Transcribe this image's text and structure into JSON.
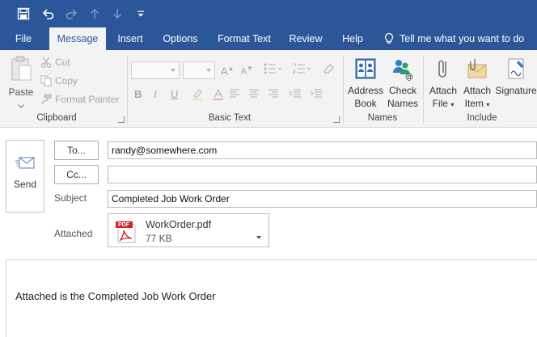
{
  "qat": {
    "icons": [
      "save-icon",
      "undo-icon",
      "redo-icon",
      "up-arrow-icon",
      "down-arrow-icon",
      "customize-icon"
    ]
  },
  "tabs": [
    {
      "label": "File",
      "active": false
    },
    {
      "label": "Message",
      "active": true
    },
    {
      "label": "Insert",
      "active": false
    },
    {
      "label": "Options",
      "active": false
    },
    {
      "label": "Format Text",
      "active": false
    },
    {
      "label": "Review",
      "active": false
    },
    {
      "label": "Help",
      "active": false
    }
  ],
  "tellme": {
    "label": "Tell me what you want to do",
    "icon": "lightbulb-icon"
  },
  "ribbon": {
    "clipboard": {
      "paste": "Paste",
      "cut": "Cut",
      "copy": "Copy",
      "format_painter": "Format Painter",
      "group": "Clipboard"
    },
    "basic_text": {
      "bold": "B",
      "italic": "I",
      "underline": "U",
      "group": "Basic Text"
    },
    "names": {
      "address_book_1": "Address",
      "address_book_2": "Book",
      "check_names_1": "Check",
      "check_names_2": "Names",
      "group": "Names"
    },
    "include": {
      "attach_file_1": "Attach",
      "attach_file_2": "File",
      "attach_item_1": "Attach",
      "attach_item_2": "Item",
      "signature": "Signature",
      "group": "Include"
    }
  },
  "compose": {
    "send": "Send",
    "to_button": "To...",
    "cc_button": "Cc...",
    "to_value": "randy@somewhere.com",
    "cc_value": "",
    "subject_label": "Subject",
    "subject_value": "Completed Job Work Order",
    "attached_label": "Attached",
    "attachment": {
      "name": "WorkOrder.pdf",
      "size": "77 KB",
      "badge": "PDF"
    },
    "body_text": "Attached is the Completed Job Work Order"
  },
  "colors": {
    "accent": "#2b579a",
    "ribbon_bg": "#f3f3f3",
    "pdf_red": "#d2232a"
  }
}
